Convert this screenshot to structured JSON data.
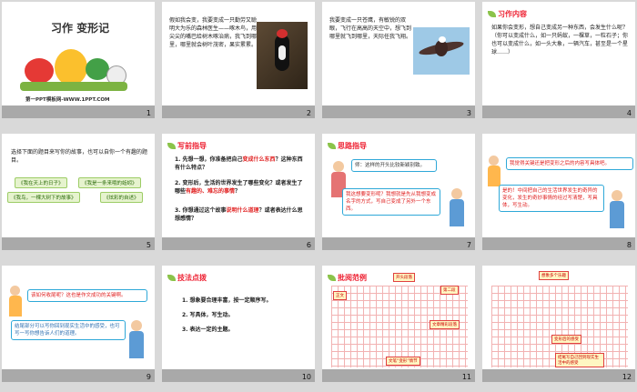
{
  "slides": [
    {
      "num": "1",
      "title": "习作  变形记",
      "subtitle": "第一PPT模板网-WWW.1PPT.COM"
    },
    {
      "num": "2",
      "text": "假如我会变，我要变成一只勤劳又聪明大为乐的森林医生——啄木鸟，用尖尖的嘴巴给树木啄治病，我飞到哪里，哪里就会树叶茂密，果实累累。"
    },
    {
      "num": "3",
      "text": "我要变成一只苍鹰，有敏锐的双眼，飞行在高高的天空中，想飞到哪里就飞到哪里，天际任我飞翔。"
    },
    {
      "num": "4",
      "header": "习作内容",
      "text": "如果你会变形，想自己变成另一种东西，会发生什么呢？（你可以变成什么，如一只蚂蚁，一棵草，一粒石子；你也可以变成什么，如一头大象，一辆汽车，甚至是一个星球……）"
    },
    {
      "num": "5",
      "text": "选择下面的题目来写你的故事，也可以自你一个有趣的题目。",
      "chips": [
        "《我在天上的日子》",
        "《我是一条来哦的蚯蚓》",
        "《我鸟，一棵大树下的故事》",
        "《炫彩的自述》"
      ]
    },
    {
      "num": "6",
      "header": "写前指导",
      "q1": "1. 先想一想，你准备把自己",
      "q1r": "变成什么东西",
      "q1e": "？这种东西有什么特点？",
      "q2": "2. 变形后，生活的世界发生了哪些变化？或者发生了哪些",
      "q2r": "有趣的、难忘的事情",
      "q2e": "？",
      "q3": "3. 你想通过这个故事",
      "q3r": "说明什么道理",
      "q3e": "？或者表达什么思想感情？"
    },
    {
      "num": "7",
      "header": "思路指导",
      "b1": "师：这样的开头比较新颖别致。",
      "b2": "我这想要变形呢？我想就是先从我想变成名字的方式，写自己变成了另外一个东西。"
    },
    {
      "num": "8",
      "b1": "我觉得关键还是把变形之后的内容写具体吧。",
      "b2": "是的！中间把自己的生活世界发生的奇异的变化，发生的奇妙事情的经过写清楚，写具体，写生动。"
    },
    {
      "num": "9",
      "b1": "该如何收尾呢？这也是作文成功的关键啊。",
      "b2": "结尾部分可以写你回到现实生活中的感受，也可写一写你想告诉人们的道理。"
    },
    {
      "num": "10",
      "header": "技法点拨",
      "items": [
        "1. 想象要合理丰富，按一定顺序写。",
        "2. 写具体，写生动。",
        "3. 表达一定的主题。"
      ]
    },
    {
      "num": "11",
      "header": "批阅范例",
      "tags": [
        "开头段落",
        "正文",
        "第二段",
        "文章精彩段落",
        "文笔“变形”情节"
      ]
    },
    {
      "num": "12",
      "tags": [
        "想象多个乐趣",
        "变形后的感受",
        "结尾写自己回到现实生活中的感受"
      ]
    }
  ]
}
